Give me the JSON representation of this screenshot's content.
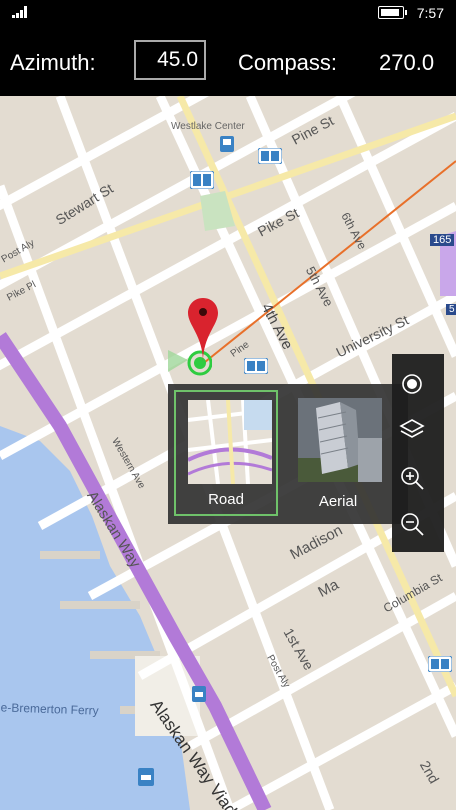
{
  "status": {
    "time": "7:57",
    "battery_level": 0.9
  },
  "header": {
    "azimuth_label": "Azimuth:",
    "azimuth_value": "45.0",
    "compass_label": "Compass:",
    "compass_value": "270.0"
  },
  "map": {
    "place_labels": [
      "Westlake Center",
      "Pine St",
      "Stewart St",
      "Pike St",
      "5th Ave",
      "4th Ave",
      "University St",
      "Post Aly",
      "Pike Pl",
      "Western Ave",
      "Alaskan Way",
      "Madison",
      "Ma",
      "Columbia St",
      "1st Ave",
      "Post Aly",
      "Alaskan Way Viad",
      "le-Bremerton Ferry",
      "2nd",
      "6th Ave",
      "165",
      "5",
      "Pine"
    ],
    "heading_line_color": "#e8702a",
    "pin_color": "#d9232e",
    "location_color": "#2ecc40"
  },
  "layers": {
    "options": [
      {
        "label": "Road",
        "selected": true
      },
      {
        "label": "Aerial",
        "selected": false
      }
    ]
  },
  "controls": {
    "buttons": [
      "my-location",
      "layers",
      "zoom-in",
      "zoom-out"
    ]
  }
}
